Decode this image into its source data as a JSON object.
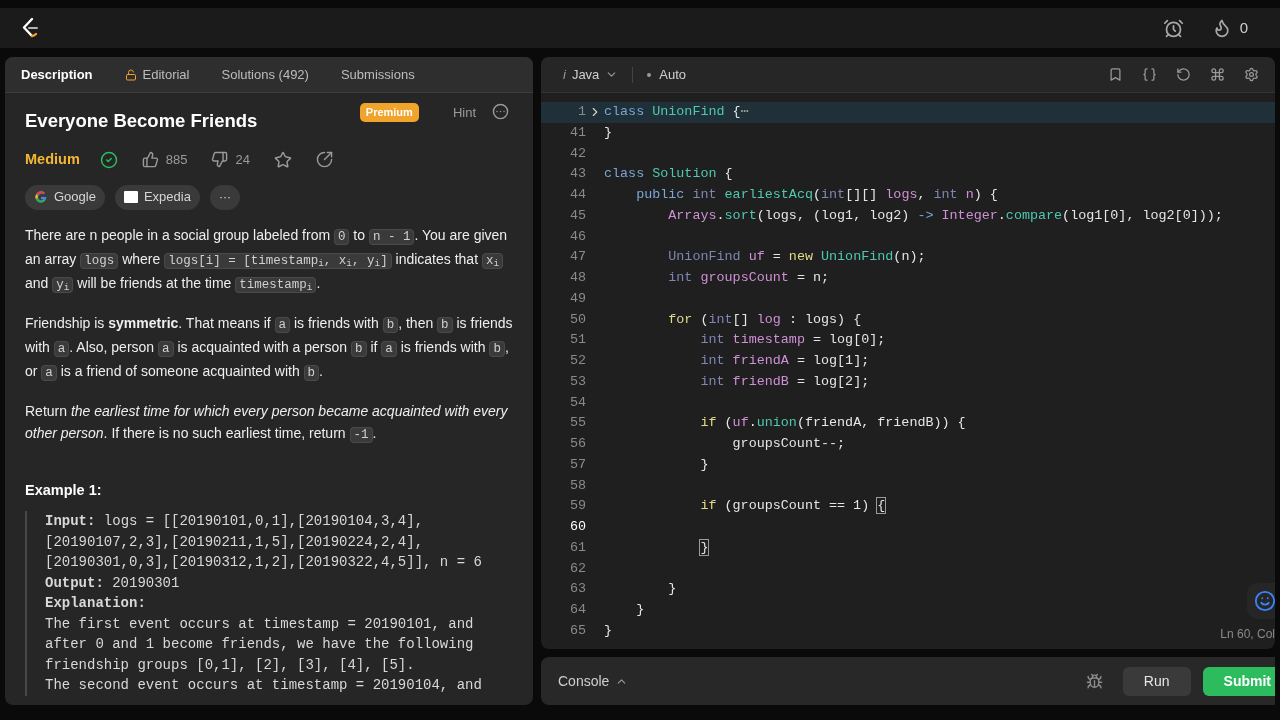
{
  "header": {
    "streak": "0"
  },
  "tabs": [
    {
      "label": "Description",
      "selected": true,
      "kind": "plain"
    },
    {
      "label": "Editorial",
      "selected": false,
      "kind": "locked"
    },
    {
      "label": "Solutions (492)",
      "selected": false,
      "kind": "plain"
    },
    {
      "label": "Submissions",
      "selected": false,
      "kind": "plain"
    }
  ],
  "problem": {
    "title": "Everyone Become Friends",
    "badge": "Premium",
    "hint": "Hint",
    "difficulty": "Medium",
    "solved": true,
    "likes": "885",
    "dislikes": "24",
    "companies": [
      {
        "name": "Google",
        "kind": "google"
      },
      {
        "name": "Expedia",
        "kind": "expedia"
      }
    ],
    "more_tags": "···",
    "paragraphs": [
      [
        {
          "text": "There are n people in a social group labeled from ",
          "kind": "text"
        },
        {
          "text": "0",
          "kind": "code"
        },
        {
          "text": " to ",
          "kind": "text"
        },
        {
          "text": "n - 1",
          "kind": "code"
        },
        {
          "text": ". You are given an array ",
          "kind": "text"
        },
        {
          "text": "logs",
          "kind": "code"
        },
        {
          "text": " where ",
          "kind": "text"
        },
        {
          "text": "logs[i] = [timestamp$_{i}$, x$_{i}$, y$_{i}$]",
          "kind": "code"
        },
        {
          "text": " indicates that ",
          "kind": "text"
        },
        {
          "text": "x$_{i}$",
          "kind": "code"
        },
        {
          "text": " and ",
          "kind": "text"
        },
        {
          "text": "y$_{i}$",
          "kind": "code"
        },
        {
          "text": " will be friends at the time ",
          "kind": "text"
        },
        {
          "text": "timestamp$_{i}$",
          "kind": "code"
        },
        {
          "text": ".",
          "kind": "text"
        }
      ],
      [
        {
          "text": "Friendship is ",
          "kind": "text"
        },
        {
          "text": "symmetric",
          "kind": "bold"
        },
        {
          "text": ". That means if ",
          "kind": "text"
        },
        {
          "text": "a",
          "kind": "code"
        },
        {
          "text": " is friends with ",
          "kind": "text"
        },
        {
          "text": "b",
          "kind": "code"
        },
        {
          "text": ", then ",
          "kind": "text"
        },
        {
          "text": "b",
          "kind": "code"
        },
        {
          "text": " is friends with ",
          "kind": "text"
        },
        {
          "text": "a",
          "kind": "code"
        },
        {
          "text": ". Also, person ",
          "kind": "text"
        },
        {
          "text": "a",
          "kind": "code"
        },
        {
          "text": " is acquainted with a person ",
          "kind": "text"
        },
        {
          "text": "b",
          "kind": "code"
        },
        {
          "text": " if ",
          "kind": "text"
        },
        {
          "text": "a",
          "kind": "code"
        },
        {
          "text": " is friends with ",
          "kind": "text"
        },
        {
          "text": "b",
          "kind": "code"
        },
        {
          "text": ", or ",
          "kind": "text"
        },
        {
          "text": "a",
          "kind": "code"
        },
        {
          "text": " is a friend of someone acquainted with ",
          "kind": "text"
        },
        {
          "text": "b",
          "kind": "code"
        },
        {
          "text": ".",
          "kind": "text"
        }
      ],
      [
        {
          "text": "Return ",
          "kind": "text"
        },
        {
          "text": "the earliest time for which every person became acquainted with every other person",
          "kind": "italic"
        },
        {
          "text": ". If there is no such earliest time, return ",
          "kind": "text"
        },
        {
          "text": "-1",
          "kind": "code"
        },
        {
          "text": ".",
          "kind": "text"
        }
      ]
    ],
    "example_title": "Example 1:",
    "example_lines": [
      "**Input:** logs = [[20190101,0,1],[20190104,3,4],",
      "[20190107,2,3],[20190211,1,5],[20190224,2,4],",
      "[20190301,0,3],[20190312,1,2],[20190322,4,5]], n = 6",
      "**Output:** 20190301",
      "**Explanation:**",
      "The first event occurs at timestamp = 20190101, and",
      "after 0 and 1 become friends, we have the following",
      "friendship groups [0,1], [2], [3], [4], [5].",
      "The second event occurs at timestamp = 20190104, and"
    ]
  },
  "editor": {
    "language_icon": "i",
    "language": "Java",
    "mode": "Auto",
    "cursor": "Ln 60, Col",
    "lines": [
      {
        "number": "1",
        "folded": true,
        "highlighted": true,
        "active": false,
        "tokens": [
          {
            "text": "class ",
            "kind": "kw"
          },
          {
            "text": "UnionFind",
            "kind": "type"
          },
          {
            "text": " {",
            "kind": "plain"
          },
          {
            "text": "⋯",
            "kind": "dim"
          }
        ]
      },
      {
        "number": "41",
        "folded": false,
        "highlighted": false,
        "active": false,
        "tokens": [
          {
            "text": "}",
            "kind": "plain"
          }
        ]
      },
      {
        "number": "42",
        "folded": false,
        "highlighted": false,
        "active": false
      },
      {
        "number": "43",
        "folded": false,
        "highlighted": false,
        "active": false,
        "tokens": [
          {
            "text": "class ",
            "kind": "kw"
          },
          {
            "text": "Solution",
            "kind": "type"
          },
          {
            "text": " {",
            "kind": "plain"
          }
        ]
      },
      {
        "number": "44",
        "folded": false,
        "highlighted": false,
        "active": false,
        "tokens": [
          {
            "text": "    public ",
            "kind": "kw"
          },
          {
            "text": "int ",
            "kind": "prim"
          },
          {
            "text": "earliestAcq",
            "kind": "fn"
          },
          {
            "text": "(",
            "kind": "plain"
          },
          {
            "text": "int",
            "kind": "prim"
          },
          {
            "text": "[][] ",
            "kind": "plain"
          },
          {
            "text": "logs",
            "kind": "var"
          },
          {
            "text": ", ",
            "kind": "plain"
          },
          {
            "text": "int ",
            "kind": "prim"
          },
          {
            "text": "n",
            "kind": "var"
          },
          {
            "text": ") {",
            "kind": "plain"
          }
        ]
      },
      {
        "number": "45",
        "folded": false,
        "highlighted": false,
        "active": false,
        "tokens": [
          {
            "text": "        Arrays",
            "kind": "var"
          },
          {
            "text": ".",
            "kind": "plain"
          },
          {
            "text": "sort",
            "kind": "fn"
          },
          {
            "text": "(logs, (log1, log2) ",
            "kind": "plain"
          },
          {
            "text": "-> ",
            "kind": "kw"
          },
          {
            "text": "Integer",
            "kind": "var"
          },
          {
            "text": ".",
            "kind": "plain"
          },
          {
            "text": "compare",
            "kind": "fn"
          },
          {
            "text": "(log1[0], log2[0]));",
            "kind": "plain"
          }
        ]
      },
      {
        "number": "46",
        "folded": false,
        "highlighted": false,
        "active": false
      },
      {
        "number": "47",
        "folded": false,
        "highlighted": false,
        "active": false,
        "tokens": [
          {
            "text": "        UnionFind ",
            "kind": "prim"
          },
          {
            "text": "uf",
            "kind": "var"
          },
          {
            "text": " = ",
            "kind": "plain"
          },
          {
            "text": "new ",
            "kind": "ctl"
          },
          {
            "text": "UnionFind",
            "kind": "type"
          },
          {
            "text": "(n);",
            "kind": "plain"
          }
        ]
      },
      {
        "number": "48",
        "folded": false,
        "highlighted": false,
        "active": false,
        "tokens": [
          {
            "text": "        int ",
            "kind": "prim"
          },
          {
            "text": "groupsCount",
            "kind": "var"
          },
          {
            "text": " = n;",
            "kind": "plain"
          }
        ]
      },
      {
        "number": "49",
        "folded": false,
        "highlighted": false,
        "active": false
      },
      {
        "number": "50",
        "folded": false,
        "highlighted": false,
        "active": false,
        "tokens": [
          {
            "text": "        for ",
            "kind": "ctl"
          },
          {
            "text": "(",
            "kind": "plain"
          },
          {
            "text": "int",
            "kind": "prim"
          },
          {
            "text": "[] ",
            "kind": "plain"
          },
          {
            "text": "log",
            "kind": "var"
          },
          {
            "text": " : logs) {",
            "kind": "plain"
          }
        ]
      },
      {
        "number": "51",
        "folded": false,
        "highlighted": false,
        "active": false,
        "tokens": [
          {
            "text": "            int ",
            "kind": "prim"
          },
          {
            "text": "timestamp",
            "kind": "var"
          },
          {
            "text": " = log[0];",
            "kind": "plain"
          }
        ]
      },
      {
        "number": "52",
        "folded": false,
        "highlighted": false,
        "active": false,
        "tokens": [
          {
            "text": "            int ",
            "kind": "prim"
          },
          {
            "text": "friendA",
            "kind": "var"
          },
          {
            "text": " = log[1];",
            "kind": "plain"
          }
        ]
      },
      {
        "number": "53",
        "folded": false,
        "highlighted": false,
        "active": false,
        "tokens": [
          {
            "text": "            int ",
            "kind": "prim"
          },
          {
            "text": "friendB",
            "kind": "var"
          },
          {
            "text": " = log[2];",
            "kind": "plain"
          }
        ]
      },
      {
        "number": "54",
        "folded": false,
        "highlighted": false,
        "active": false
      },
      {
        "number": "55",
        "folded": false,
        "highlighted": false,
        "active": false,
        "tokens": [
          {
            "text": "            if ",
            "kind": "ctl"
          },
          {
            "text": "(",
            "kind": "plain"
          },
          {
            "text": "uf",
            "kind": "var"
          },
          {
            "text": ".",
            "kind": "plain"
          },
          {
            "text": "union",
            "kind": "fn"
          },
          {
            "text": "(friendA, friendB)) {",
            "kind": "plain"
          }
        ]
      },
      {
        "number": "56",
        "folded": false,
        "highlighted": false,
        "active": false,
        "tokens": [
          {
            "text": "                groupsCount--;",
            "kind": "plain"
          }
        ]
      },
      {
        "number": "57",
        "folded": false,
        "highlighted": false,
        "active": false,
        "tokens": [
          {
            "text": "            }",
            "kind": "plain"
          }
        ]
      },
      {
        "number": "58",
        "folded": false,
        "highlighted": false,
        "active": false
      },
      {
        "number": "59",
        "folded": false,
        "highlighted": false,
        "active": false,
        "tokens": [
          {
            "text": "            if ",
            "kind": "ctl"
          },
          {
            "text": "(groupsCount == 1) ",
            "kind": "plain"
          },
          {
            "text": "{",
            "kind": "match"
          }
        ]
      },
      {
        "number": "60",
        "folded": false,
        "highlighted": false,
        "active": true
      },
      {
        "number": "61",
        "folded": false,
        "highlighted": false,
        "active": false,
        "tokens": [
          {
            "text": "            }",
            "kind": "match"
          }
        ]
      },
      {
        "number": "62",
        "folded": false,
        "highlighted": false,
        "active": false
      },
      {
        "number": "63",
        "folded": false,
        "highlighted": false,
        "active": false,
        "tokens": [
          {
            "text": "        }",
            "kind": "plain"
          }
        ]
      },
      {
        "number": "64",
        "folded": false,
        "highlighted": false,
        "active": false,
        "tokens": [
          {
            "text": "    }",
            "kind": "plain"
          }
        ]
      },
      {
        "number": "65",
        "folded": false,
        "highlighted": false,
        "active": false,
        "tokens": [
          {
            "text": "}",
            "kind": "plain"
          }
        ]
      }
    ]
  },
  "console": {
    "label": "Console",
    "run": "Run",
    "submit": "Submit"
  }
}
